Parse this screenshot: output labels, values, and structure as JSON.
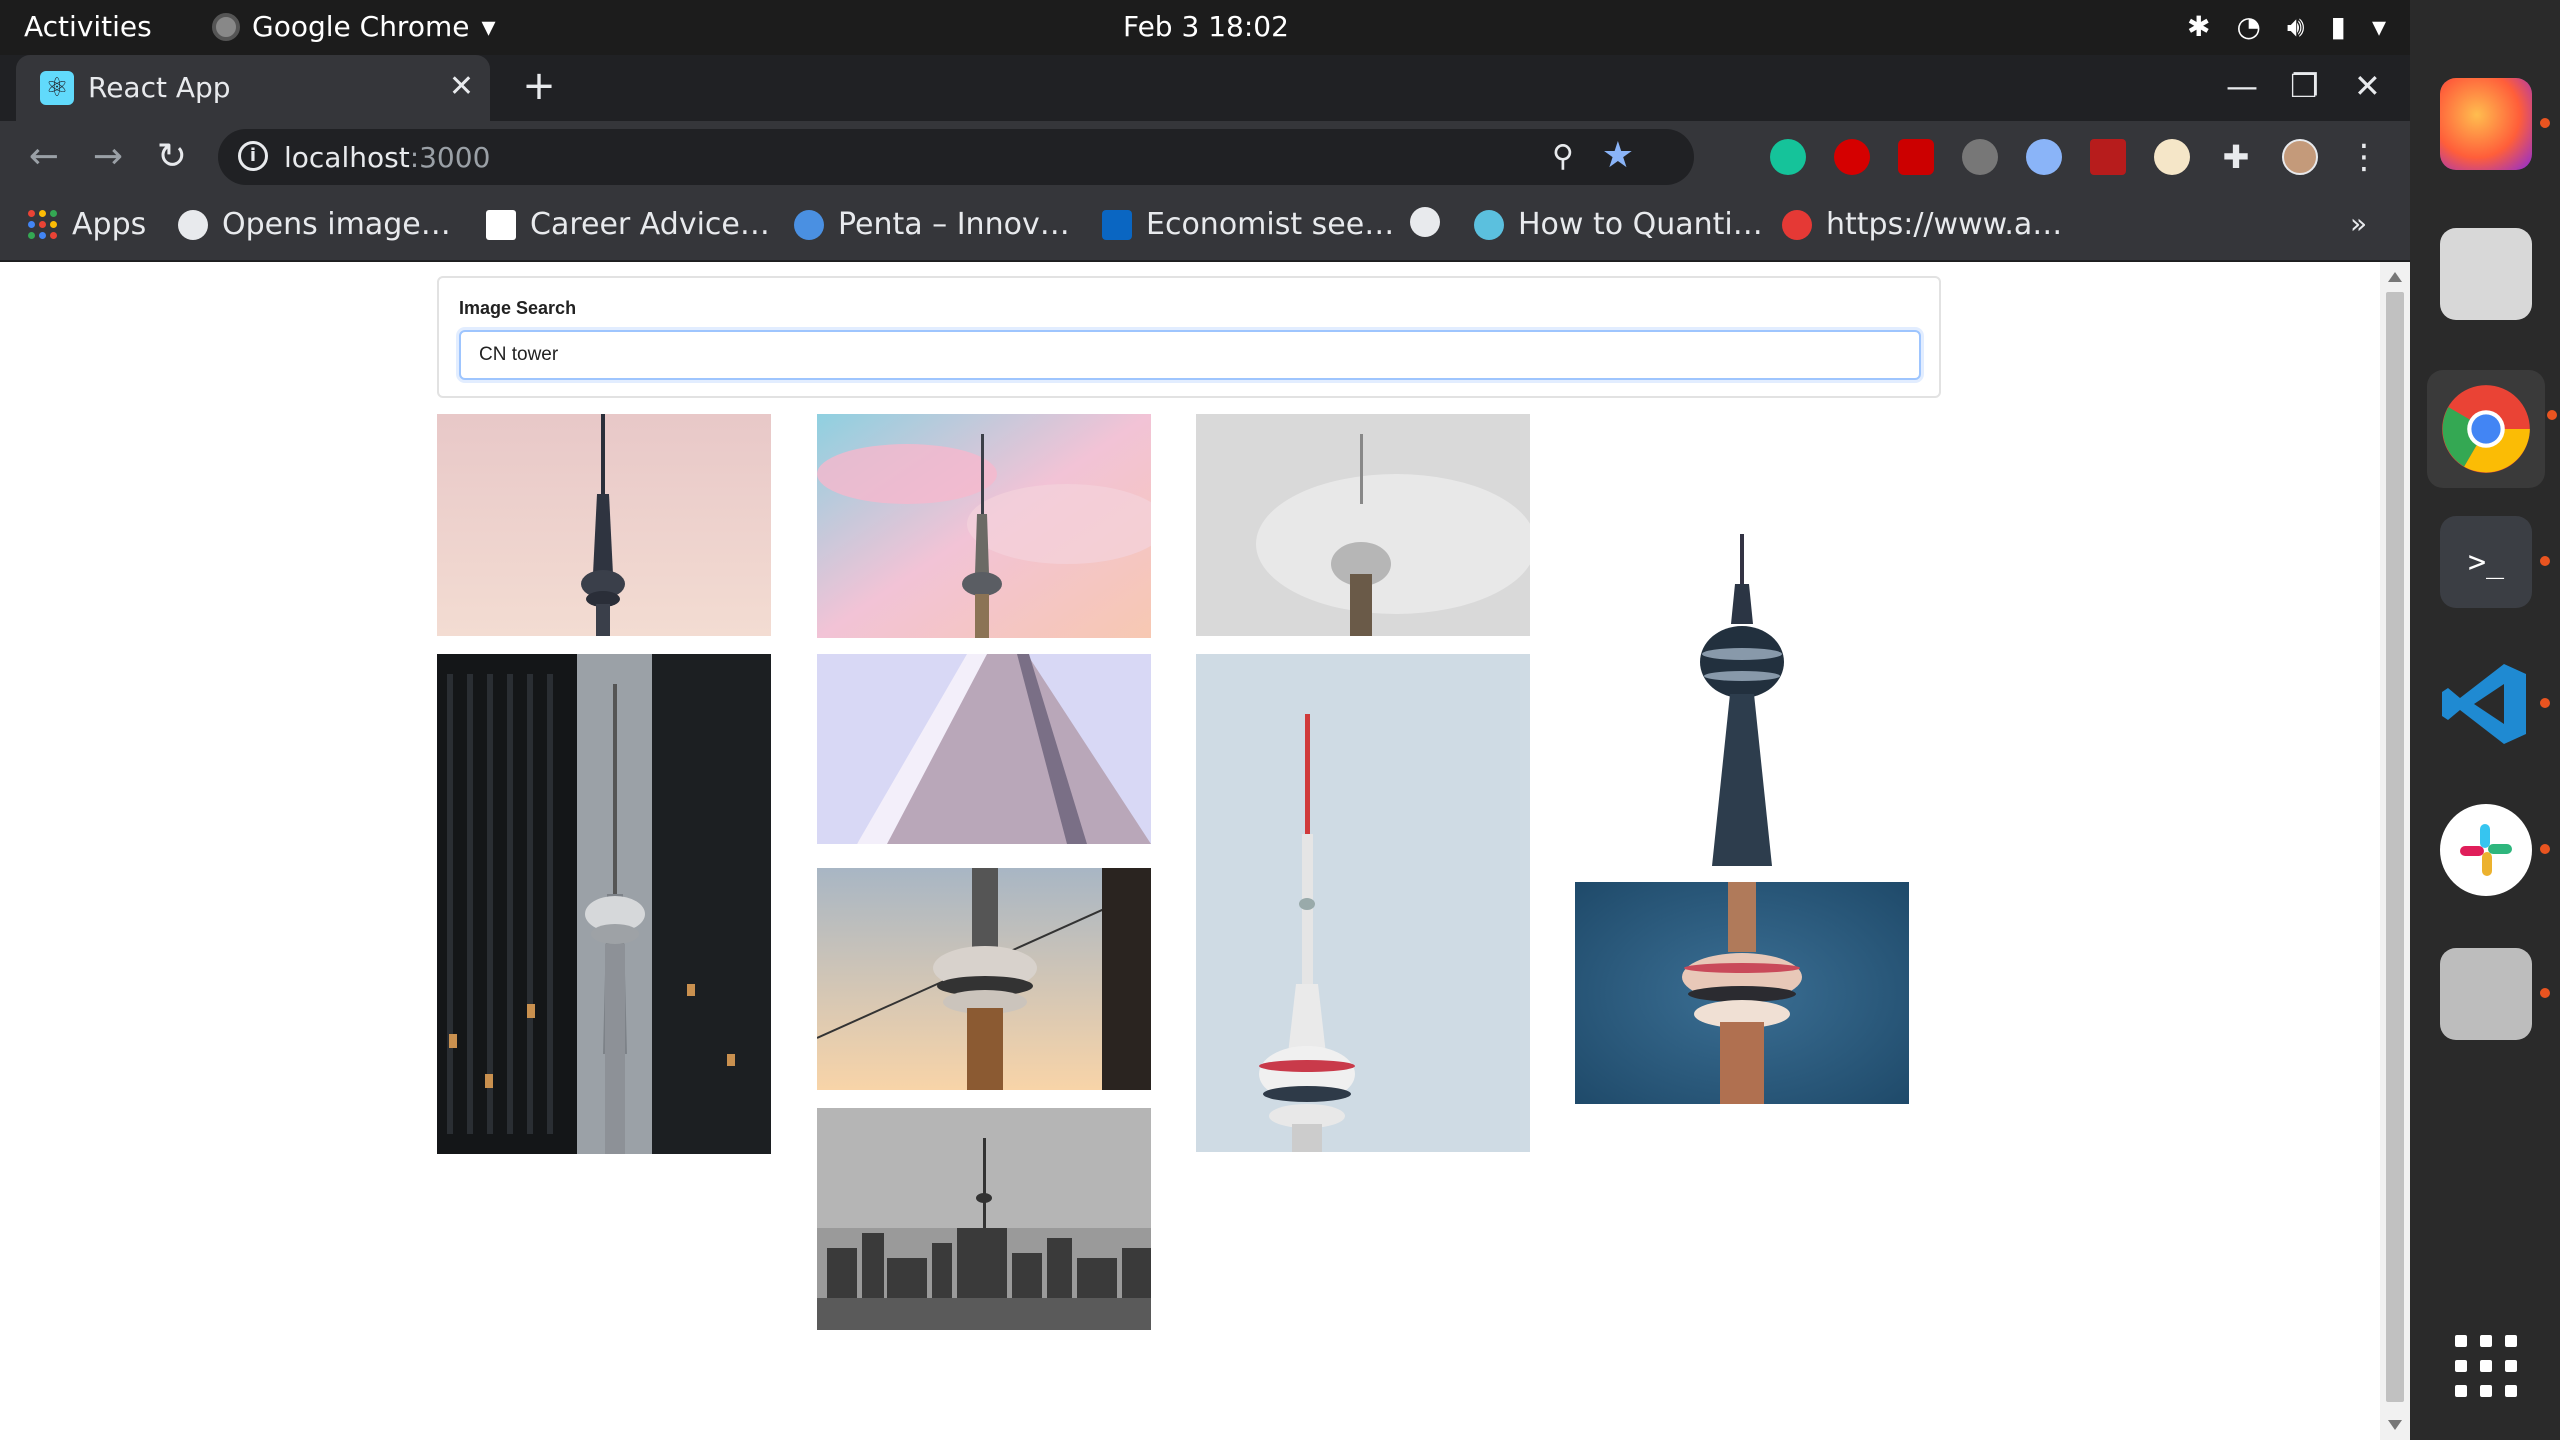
{
  "system_bar": {
    "activities": "Activities",
    "app_name": "Google Chrome",
    "clock": "Feb 3  18:02"
  },
  "browser": {
    "tab_title": "React App",
    "url_host": "localhost",
    "url_port": ":3000",
    "bookmarks": [
      {
        "label": "Apps",
        "icon": "apps-grid-icon"
      },
      {
        "label": "Opens image…",
        "icon": "globe-icon"
      },
      {
        "label": "Career Advice…",
        "icon": "chart-favicon-icon"
      },
      {
        "label": "Penta – Innov…",
        "icon": "penta-favicon-icon"
      },
      {
        "label": "Economist see…",
        "icon": "linkedin-icon"
      },
      {
        "label": "",
        "icon": "globe-icon"
      },
      {
        "label": "How to Quanti…",
        "icon": "m-favicon-icon"
      },
      {
        "label": "https://www.a…",
        "icon": "a-favicon-icon"
      }
    ]
  },
  "app": {
    "search_label": "Image Search",
    "search_value": "CN tower"
  },
  "colors": {
    "page_bg": "#ffffff",
    "input_border": "#9ec5fe",
    "dock_accent": "#e95420"
  },
  "images": [
    {
      "name": "image-cn-tower-pink-sky"
    },
    {
      "name": "image-cn-tower-pastel-clouds"
    },
    {
      "name": "image-cn-tower-fog"
    },
    {
      "name": "image-cn-tower-white-background"
    },
    {
      "name": "image-cn-tower-between-buildings"
    },
    {
      "name": "image-cn-tower-base-upward"
    },
    {
      "name": "image-cn-tower-pod-sunset"
    },
    {
      "name": "image-cn-tower-white-tall"
    },
    {
      "name": "image-cn-tower-pod-blue-sky"
    },
    {
      "name": "image-toronto-skyline-bw"
    }
  ]
}
